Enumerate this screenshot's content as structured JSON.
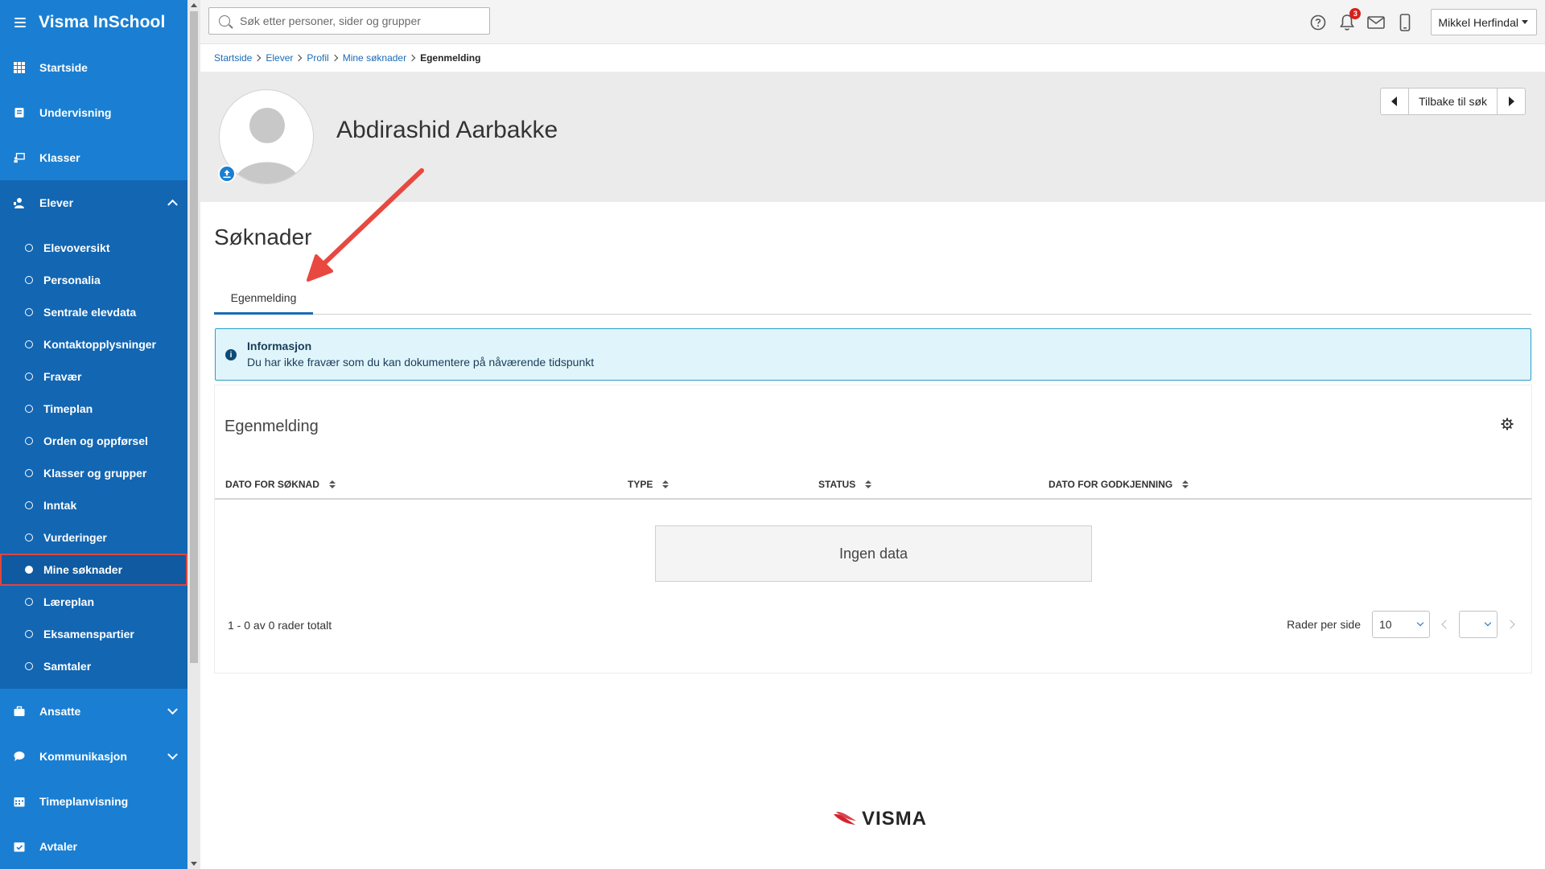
{
  "app": {
    "title": "Visma InSchool"
  },
  "sidebar": {
    "items": [
      {
        "label": "Startside",
        "icon": "grid-icon"
      },
      {
        "label": "Undervisning",
        "icon": "book-icon"
      },
      {
        "label": "Klasser",
        "icon": "classroom-icon"
      },
      {
        "label": "Elever",
        "icon": "students-icon"
      },
      {
        "label": "Ansatte",
        "icon": "briefcase-icon"
      },
      {
        "label": "Kommunikasjon",
        "icon": "chat-icon"
      },
      {
        "label": "Timeplanvisning",
        "icon": "calendar-icon"
      },
      {
        "label": "Avtaler",
        "icon": "calendar-check-icon"
      }
    ],
    "elever_sub": [
      "Elevoversikt",
      "Personalia",
      "Sentrale elevdata",
      "Kontaktopplysninger",
      "Fravær",
      "Timeplan",
      "Orden og oppførsel",
      "Klasser og grupper",
      "Inntak",
      "Vurderinger",
      "Mine søknader",
      "Læreplan",
      "Eksamenspartier",
      "Samtaler"
    ],
    "active_sub": "Mine søknader"
  },
  "topbar": {
    "search_placeholder": "Søk etter personer, sider og grupper",
    "notification_count": "3",
    "user_name": "Mikkel Herfindal"
  },
  "breadcrumb": [
    "Startside",
    "Elever",
    "Profil",
    "Mine søknader",
    "Egenmelding"
  ],
  "profile": {
    "name": "Abdirashid Aarbakke",
    "back_label": "Tilbake til søk"
  },
  "page": {
    "heading": "Søknader",
    "tabs": [
      "Egenmelding"
    ],
    "info_title": "Informasjon",
    "info_text": "Du har ikke fravær som du kan dokumentere på nåværende tidspunkt"
  },
  "table": {
    "title": "Egenmelding",
    "columns": [
      "DATO FOR SØKNAD",
      "TYPE",
      "STATUS",
      "DATO FOR GODKJENNING"
    ],
    "empty_text": "Ingen data",
    "rows_summary": "1 - 0 av 0 rader totalt",
    "rows_per_page_label": "Rader per side",
    "rows_per_page_value": "10",
    "page_value": ""
  },
  "footer": {
    "logo_text": "VISMA"
  },
  "colors": {
    "sidebar": "#1a7fd3",
    "sidebar_active": "#1366b2",
    "highlight": "#e0463c",
    "link": "#1b6bb5",
    "info_bg": "#dff5fb"
  }
}
